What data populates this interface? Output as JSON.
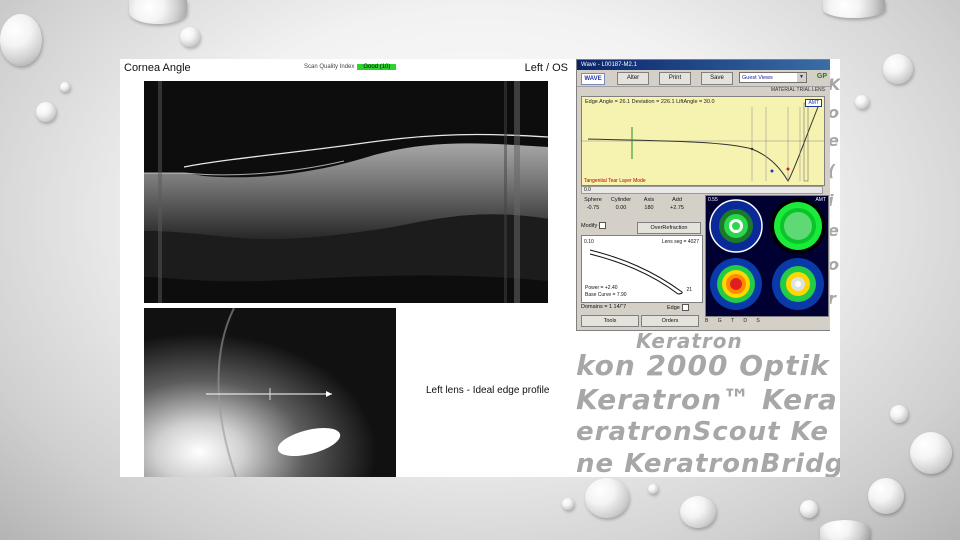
{
  "oct": {
    "title": "Cornea Angle",
    "quality_label": "Scan Quality Index",
    "quality_value": "Good (10)",
    "eye": "Left / OS"
  },
  "photo": {
    "caption": "Left lens - Ideal edge profile"
  },
  "software": {
    "window_title": "Wave - L00187-M2.1",
    "logo": "WAVE",
    "buttons": {
      "alter": "Alter",
      "print": "Print",
      "save": "Save"
    },
    "view_select": "Guest Views",
    "gp_tag": "GP",
    "material": "MATERIAL  TRIAL LENS",
    "graph": {
      "header": "Edge Angle = 26.1   Deviation = 226.1   LiftAngle = 30.0",
      "footer": "Tangential Tear Layer Mode",
      "badge": "AMT",
      "scale_label": "0.0"
    },
    "params": {
      "headers": [
        "Sphere",
        "Cylinder",
        "Axis",
        "Add"
      ],
      "values": [
        "-0.75",
        "0.00",
        "180",
        "+2.75"
      ]
    },
    "modify_label": "Modify",
    "over_button": "OverRefraction",
    "profile": {
      "lens_seg": "Lens seg = 4027",
      "power": "Power = +2.40",
      "base_curve": "Base Curve = 7.90",
      "value": "21",
      "left_label": "0.10"
    },
    "domains": "Domains = 1 14/\"7",
    "edge_label": "Edge",
    "tools_button": "Tools",
    "orders_button": "Orders",
    "map_labels": {
      "top_left": "0.55",
      "top_right": "AMT"
    },
    "map_footer": [
      "B",
      "G",
      "T",
      "D",
      "S"
    ]
  },
  "brands": [
    "Keratron",
    "kon 2000 Optik",
    "Keratron™ Kera",
    "eratronScout Ke",
    "ne KeratronBridg"
  ],
  "side_letters": [
    "K",
    "o",
    "e",
    "(",
    "i",
    "e",
    "o",
    "r"
  ],
  "colors": {
    "graph_bg": "#f6f3b0",
    "quality_badge": "#2ed12e",
    "brand_text": "#a7a7a7",
    "titlebar": "#0a246a"
  }
}
